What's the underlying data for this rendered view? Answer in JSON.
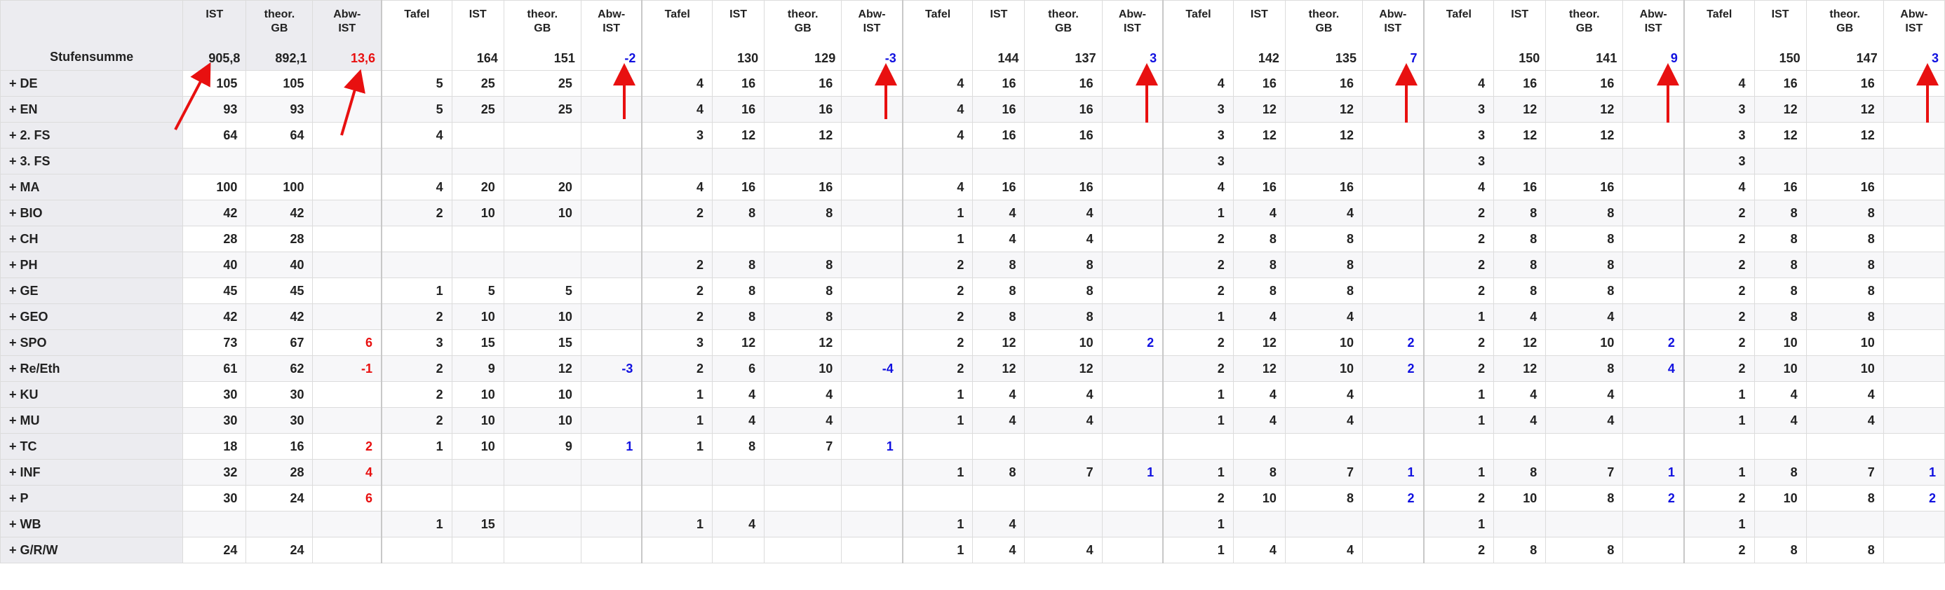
{
  "header": {
    "row_label_title": "Stufensumme",
    "sum_columns": [
      {
        "title_line1": "IST",
        "title_line2": "",
        "value": "905,8",
        "value_color": "normal"
      },
      {
        "title_line1": "theor.",
        "title_line2": "GB",
        "value": "892,1",
        "value_color": "normal"
      },
      {
        "title_line1": "Abw-",
        "title_line2": "IST",
        "value": "13,6",
        "value_color": "red"
      }
    ],
    "group_column_titles": [
      {
        "l1": "Tafel",
        "l2": ""
      },
      {
        "l1": "IST",
        "l2": ""
      },
      {
        "l1": "theor.",
        "l2": "GB"
      },
      {
        "l1": "Abw-",
        "l2": "IST"
      }
    ],
    "groups": [
      {
        "tafel": "",
        "ist": "164",
        "theor": "151",
        "abw": "-2"
      },
      {
        "tafel": "",
        "ist": "130",
        "theor": "129",
        "abw": "-3"
      },
      {
        "tafel": "",
        "ist": "144",
        "theor": "137",
        "abw": "3"
      },
      {
        "tafel": "",
        "ist": "142",
        "theor": "135",
        "abw": "7"
      },
      {
        "tafel": "",
        "ist": "150",
        "theor": "141",
        "abw": "9"
      },
      {
        "tafel": "",
        "ist": "150",
        "theor": "147",
        "abw": "3"
      }
    ]
  },
  "rows": [
    {
      "label": "+ DE",
      "ist": "105",
      "theor": "105",
      "abw": "",
      "groups": [
        [
          "5",
          "25",
          "25",
          ""
        ],
        [
          "4",
          "16",
          "16",
          ""
        ],
        [
          "4",
          "16",
          "16",
          ""
        ],
        [
          "4",
          "16",
          "16",
          ""
        ],
        [
          "4",
          "16",
          "16",
          ""
        ],
        [
          "4",
          "16",
          "16",
          ""
        ]
      ]
    },
    {
      "label": "+ EN",
      "ist": "93",
      "theor": "93",
      "abw": "",
      "groups": [
        [
          "5",
          "25",
          "25",
          ""
        ],
        [
          "4",
          "16",
          "16",
          ""
        ],
        [
          "4",
          "16",
          "16",
          ""
        ],
        [
          "3",
          "12",
          "12",
          ""
        ],
        [
          "3",
          "12",
          "12",
          ""
        ],
        [
          "3",
          "12",
          "12",
          ""
        ]
      ]
    },
    {
      "label": "+ 2. FS",
      "ist": "64",
      "theor": "64",
      "abw": "",
      "groups": [
        [
          "4",
          "",
          "",
          ""
        ],
        [
          "3",
          "12",
          "12",
          ""
        ],
        [
          "4",
          "16",
          "16",
          ""
        ],
        [
          "3",
          "12",
          "12",
          ""
        ],
        [
          "3",
          "12",
          "12",
          ""
        ],
        [
          "3",
          "12",
          "12",
          ""
        ]
      ]
    },
    {
      "label": "+ 3. FS",
      "ist": "",
      "theor": "",
      "abw": "",
      "groups": [
        [
          "",
          "",
          "",
          ""
        ],
        [
          "",
          "",
          "",
          ""
        ],
        [
          "",
          "",
          "",
          ""
        ],
        [
          "3",
          "",
          "",
          ""
        ],
        [
          "3",
          "",
          "",
          ""
        ],
        [
          "3",
          "",
          "",
          ""
        ]
      ]
    },
    {
      "label": "+ MA",
      "ist": "100",
      "theor": "100",
      "abw": "",
      "groups": [
        [
          "4",
          "20",
          "20",
          ""
        ],
        [
          "4",
          "16",
          "16",
          ""
        ],
        [
          "4",
          "16",
          "16",
          ""
        ],
        [
          "4",
          "16",
          "16",
          ""
        ],
        [
          "4",
          "16",
          "16",
          ""
        ],
        [
          "4",
          "16",
          "16",
          ""
        ]
      ]
    },
    {
      "label": "+ BIO",
      "ist": "42",
      "theor": "42",
      "abw": "",
      "groups": [
        [
          "2",
          "10",
          "10",
          ""
        ],
        [
          "2",
          "8",
          "8",
          ""
        ],
        [
          "1",
          "4",
          "4",
          ""
        ],
        [
          "1",
          "4",
          "4",
          ""
        ],
        [
          "2",
          "8",
          "8",
          ""
        ],
        [
          "2",
          "8",
          "8",
          ""
        ]
      ]
    },
    {
      "label": "+ CH",
      "ist": "28",
      "theor": "28",
      "abw": "",
      "groups": [
        [
          "",
          "",
          "",
          ""
        ],
        [
          "",
          "",
          "",
          ""
        ],
        [
          "1",
          "4",
          "4",
          ""
        ],
        [
          "2",
          "8",
          "8",
          ""
        ],
        [
          "2",
          "8",
          "8",
          ""
        ],
        [
          "2",
          "8",
          "8",
          ""
        ]
      ]
    },
    {
      "label": "+ PH",
      "ist": "40",
      "theor": "40",
      "abw": "",
      "groups": [
        [
          "",
          "",
          "",
          ""
        ],
        [
          "2",
          "8",
          "8",
          ""
        ],
        [
          "2",
          "8",
          "8",
          ""
        ],
        [
          "2",
          "8",
          "8",
          ""
        ],
        [
          "2",
          "8",
          "8",
          ""
        ],
        [
          "2",
          "8",
          "8",
          ""
        ]
      ]
    },
    {
      "label": "+ GE",
      "ist": "45",
      "theor": "45",
      "abw": "",
      "groups": [
        [
          "1",
          "5",
          "5",
          ""
        ],
        [
          "2",
          "8",
          "8",
          ""
        ],
        [
          "2",
          "8",
          "8",
          ""
        ],
        [
          "2",
          "8",
          "8",
          ""
        ],
        [
          "2",
          "8",
          "8",
          ""
        ],
        [
          "2",
          "8",
          "8",
          ""
        ]
      ]
    },
    {
      "label": "+ GEO",
      "ist": "42",
      "theor": "42",
      "abw": "",
      "groups": [
        [
          "2",
          "10",
          "10",
          ""
        ],
        [
          "2",
          "8",
          "8",
          ""
        ],
        [
          "2",
          "8",
          "8",
          ""
        ],
        [
          "1",
          "4",
          "4",
          ""
        ],
        [
          "1",
          "4",
          "4",
          ""
        ],
        [
          "2",
          "8",
          "8",
          ""
        ]
      ]
    },
    {
      "label": "+ SPO",
      "ist": "73",
      "theor": "67",
      "abw": "6",
      "groups": [
        [
          "3",
          "15",
          "15",
          ""
        ],
        [
          "3",
          "12",
          "12",
          ""
        ],
        [
          "2",
          "12",
          "10",
          "2"
        ],
        [
          "2",
          "12",
          "10",
          "2"
        ],
        [
          "2",
          "12",
          "10",
          "2"
        ],
        [
          "2",
          "10",
          "10",
          ""
        ]
      ]
    },
    {
      "label": "+ Re/Eth",
      "ist": "61",
      "theor": "62",
      "abw": "-1",
      "groups": [
        [
          "2",
          "9",
          "12",
          "-3"
        ],
        [
          "2",
          "6",
          "10",
          "-4"
        ],
        [
          "2",
          "12",
          "12",
          ""
        ],
        [
          "2",
          "12",
          "10",
          "2"
        ],
        [
          "2",
          "12",
          "8",
          "4"
        ],
        [
          "2",
          "10",
          "10",
          ""
        ]
      ]
    },
    {
      "label": "+ KU",
      "ist": "30",
      "theor": "30",
      "abw": "",
      "groups": [
        [
          "2",
          "10",
          "10",
          ""
        ],
        [
          "1",
          "4",
          "4",
          ""
        ],
        [
          "1",
          "4",
          "4",
          ""
        ],
        [
          "1",
          "4",
          "4",
          ""
        ],
        [
          "1",
          "4",
          "4",
          ""
        ],
        [
          "1",
          "4",
          "4",
          ""
        ]
      ]
    },
    {
      "label": "+ MU",
      "ist": "30",
      "theor": "30",
      "abw": "",
      "groups": [
        [
          "2",
          "10",
          "10",
          ""
        ],
        [
          "1",
          "4",
          "4",
          ""
        ],
        [
          "1",
          "4",
          "4",
          ""
        ],
        [
          "1",
          "4",
          "4",
          ""
        ],
        [
          "1",
          "4",
          "4",
          ""
        ],
        [
          "1",
          "4",
          "4",
          ""
        ]
      ]
    },
    {
      "label": "+ TC",
      "ist": "18",
      "theor": "16",
      "abw": "2",
      "groups": [
        [
          "1",
          "10",
          "9",
          "1"
        ],
        [
          "1",
          "8",
          "7",
          "1"
        ],
        [
          "",
          "",
          "",
          ""
        ],
        [
          "",
          "",
          "",
          ""
        ],
        [
          "",
          "",
          "",
          ""
        ],
        [
          "",
          "",
          "",
          ""
        ]
      ]
    },
    {
      "label": "+ INF",
      "ist": "32",
      "theor": "28",
      "abw": "4",
      "groups": [
        [
          "",
          "",
          "",
          ""
        ],
        [
          "",
          "",
          "",
          ""
        ],
        [
          "1",
          "8",
          "7",
          "1"
        ],
        [
          "1",
          "8",
          "7",
          "1"
        ],
        [
          "1",
          "8",
          "7",
          "1"
        ],
        [
          "1",
          "8",
          "7",
          "1"
        ]
      ]
    },
    {
      "label": "+ P",
      "ist": "30",
      "theor": "24",
      "abw": "6",
      "groups": [
        [
          "",
          "",
          "",
          ""
        ],
        [
          "",
          "",
          "",
          ""
        ],
        [
          "",
          "",
          "",
          ""
        ],
        [
          "2",
          "10",
          "8",
          "2"
        ],
        [
          "2",
          "10",
          "8",
          "2"
        ],
        [
          "2",
          "10",
          "8",
          "2"
        ]
      ]
    },
    {
      "label": "+ WB",
      "ist": "",
      "theor": "",
      "abw": "",
      "groups": [
        [
          "1",
          "15",
          "",
          ""
        ],
        [
          "1",
          "4",
          "",
          ""
        ],
        [
          "1",
          "4",
          "",
          ""
        ],
        [
          "1",
          "",
          "",
          ""
        ],
        [
          "1",
          "",
          "",
          ""
        ],
        [
          "1",
          "",
          "",
          ""
        ]
      ]
    },
    {
      "label": "+ G/R/W",
      "ist": "24",
      "theor": "24",
      "abw": "",
      "groups": [
        [
          "",
          "",
          "",
          ""
        ],
        [
          "",
          "",
          "",
          ""
        ],
        [
          "1",
          "4",
          "4",
          ""
        ],
        [
          "1",
          "4",
          "4",
          ""
        ],
        [
          "2",
          "8",
          "8",
          ""
        ],
        [
          "2",
          "8",
          "8",
          ""
        ]
      ]
    }
  ],
  "colors": {
    "negative_or_group_abw": "#1010e0",
    "sum_abw": "#e81010",
    "arrow": "#e81010"
  }
}
